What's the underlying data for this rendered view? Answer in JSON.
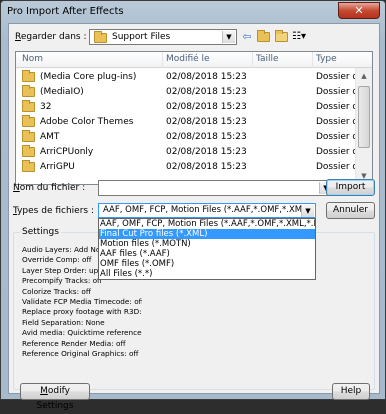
{
  "window": {
    "title": "Pro Import After Effects",
    "close": "✕"
  },
  "toolbar": {
    "look_in_label": "Regarder dans :",
    "look_in_value": "Support Files"
  },
  "file_list": {
    "columns": [
      "Nom",
      "Modifié le",
      "Taille",
      "Type"
    ],
    "rows": [
      {
        "name": "(Media Core plug-ins)",
        "modified": "02/08/2018 15:23",
        "size": "",
        "type": "Dossier de fi..."
      },
      {
        "name": "(MediaIO)",
        "modified": "02/08/2018 15:23",
        "size": "",
        "type": "Dossier de fi..."
      },
      {
        "name": "32",
        "modified": "02/08/2018 15:23",
        "size": "",
        "type": "Dossier de fi..."
      },
      {
        "name": "Adobe Color Themes",
        "modified": "02/08/2018 15:23",
        "size": "",
        "type": "Dossier de fi..."
      },
      {
        "name": "AMT",
        "modified": "02/08/2018 15:23",
        "size": "",
        "type": "Dossier de fi..."
      },
      {
        "name": "ArriCPUonly",
        "modified": "02/08/2018 15:23",
        "size": "",
        "type": "Dossier de fi..."
      },
      {
        "name": "ArriGPU",
        "modified": "02/08/2018 15:23",
        "size": "",
        "type": "Dossier de fi..."
      }
    ]
  },
  "filename": {
    "label": "Nom du fichier :",
    "value": ""
  },
  "filetype": {
    "label": "Types de fichiers :",
    "value": "AAF, OMF, FCP, Motion Files (*.AAF,*.OMF,*.XML,*.MO",
    "options": [
      "AAF, OMF, FCP, Motion Files (*.AAF,*.OMF,*.XML,*.MOTN)",
      "Final Cut Pro files (*.XML)",
      "Motion files (*.MOTN)",
      "AAF files (*.AAF)",
      "OMF files (*.OMF)",
      "All Files (*.*)"
    ],
    "selected_index": 1
  },
  "buttons": {
    "import": "Import",
    "cancel": "Annuler",
    "modify": "Modify Settings",
    "help": "Help"
  },
  "settings": {
    "title": "Settings",
    "lines": [
      "Audio Layers: Add Normal",
      "Override Comp: off",
      "Layer Step Order: up",
      "Precompify Tracks: off",
      "Colorize Tracks: off",
      "Validate FCP Media Timecode: off",
      "Replace proxy footage with R3D: off",
      "Field Separation: None",
      "Avid media: Quicktime reference",
      "Reference Render Media: off",
      "Reference Original Graphics: off"
    ]
  },
  "colors": {
    "selection": "#3399ff",
    "title_bar": "#b9c9d8",
    "close_button": "#c74a33"
  }
}
